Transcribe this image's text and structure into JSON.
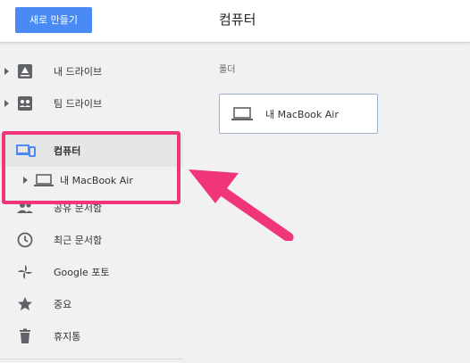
{
  "header": {
    "new_button": "새로 만들기",
    "title": "컴퓨터"
  },
  "sidebar": {
    "items": [
      {
        "label": "내 드라이브",
        "icon": "drive-icon"
      },
      {
        "label": "팀 드라이브",
        "icon": "team-drive-icon"
      },
      {
        "label": "컴퓨터",
        "icon": "computers-icon",
        "selected": true
      },
      {
        "label": "공유 문서함",
        "icon": "shared-people-icon"
      },
      {
        "label": "최근 문서함",
        "icon": "clock-icon"
      },
      {
        "label": "Google 포토",
        "icon": "photos-pinwheel-icon"
      },
      {
        "label": "중요",
        "icon": "star-icon"
      },
      {
        "label": "휴지통",
        "icon": "trash-icon"
      }
    ],
    "computer_child": {
      "label": "내 MacBook Air",
      "icon": "laptop-icon"
    }
  },
  "main": {
    "section_label": "폴더",
    "folders": [
      {
        "label": "내 MacBook Air",
        "icon": "laptop-icon"
      }
    ]
  },
  "colors": {
    "accent": "#4a8af4",
    "highlight": "#f0357a",
    "selected_bg": "#e6e6e6",
    "icon_gray": "#5f6368"
  }
}
